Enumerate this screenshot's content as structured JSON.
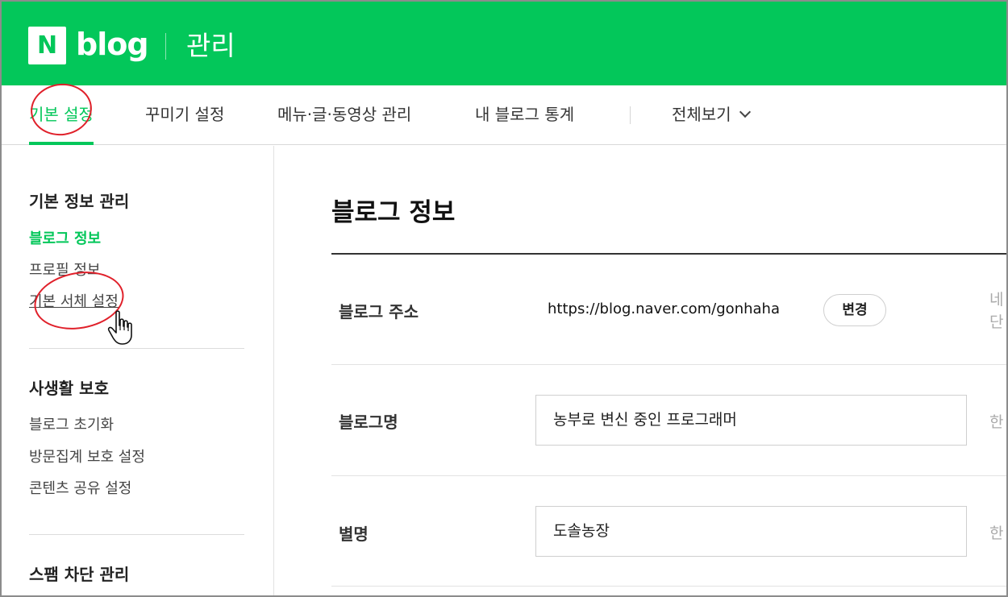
{
  "header": {
    "logo_letter": "N",
    "logo_word": "blog",
    "section_title": "관리",
    "brand_color": "#03c75a"
  },
  "tabs": [
    {
      "label": "기본 설정",
      "active": true
    },
    {
      "label": "꾸미기 설정",
      "active": false
    },
    {
      "label": "메뉴·글·동영상 관리",
      "active": false
    },
    {
      "label": "내 블로그 통계",
      "active": false
    },
    {
      "label": "전체보기",
      "active": false,
      "icon": "chevron-down-icon"
    }
  ],
  "sidebar": {
    "groups": [
      {
        "title": "기본 정보 관리",
        "items": [
          {
            "label": "블로그 정보",
            "active": true
          },
          {
            "label": "프로필 정보",
            "active": false
          },
          {
            "label": "기본 서체 설정",
            "active": false,
            "hovered": true
          }
        ]
      },
      {
        "title": "사생활 보호",
        "items": [
          {
            "label": "블로그 초기화",
            "active": false
          },
          {
            "label": "방문집계 보호 설정",
            "active": false
          },
          {
            "label": "콘텐츠 공유 설정",
            "active": false
          }
        ]
      },
      {
        "title": "스팸 차단 관리",
        "items": []
      }
    ]
  },
  "main": {
    "title": "블로그 정보",
    "rows": {
      "address": {
        "label": "블로그 주소",
        "value": "https://blog.naver.com/gonhaha",
        "button_label": "변경",
        "side_text_1": "네",
        "side_text_2": "단"
      },
      "name": {
        "label": "블로그명",
        "value": "농부로 변신 중인 프로그래머",
        "side_text": "한"
      },
      "nickname": {
        "label": "별명",
        "value": "도솔농장",
        "side_text": "한"
      }
    }
  },
  "annotations": {
    "circle_color": "#e0202a",
    "cursor_icon": "hand-pointer-icon"
  }
}
